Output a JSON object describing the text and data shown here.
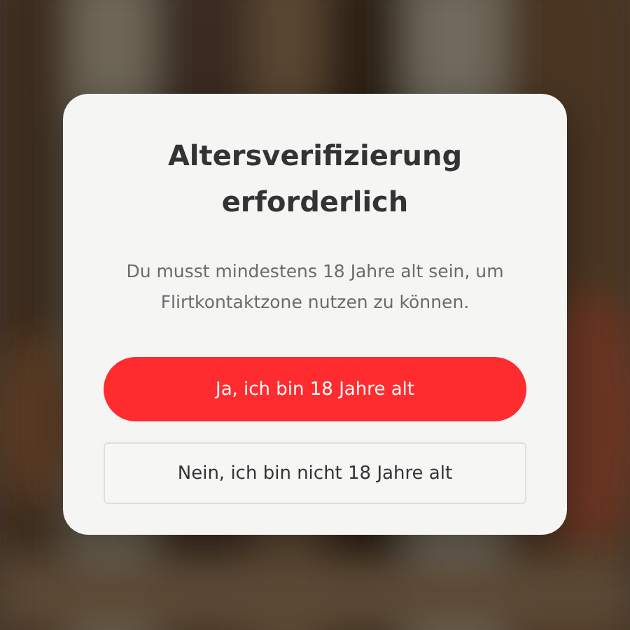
{
  "dialog": {
    "title": "Altersverifizierung erforderlich",
    "message": "Du musst mindestens 18 Jahre alt sein, um Flirtkontaktzone nutzen zu können.",
    "buttons": [
      {
        "label": "Ja, ich bin 18 Jahre alt",
        "kind": "primary"
      },
      {
        "label": "Nein, ich bin nicht 18 Jahre alt",
        "kind": "secondary"
      }
    ]
  }
}
